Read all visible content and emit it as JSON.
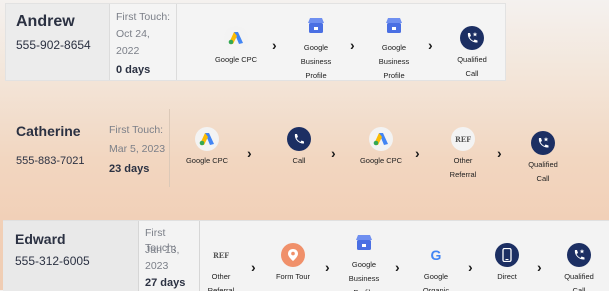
{
  "leads": [
    {
      "name": "Andrew",
      "phone": "555-902-8654",
      "first_touch_label": "First Touch:",
      "first_touch_date_line1": "Oct 24,",
      "first_touch_date_line2": "2022",
      "days": "0 days",
      "steps": [
        {
          "label": "Google CPC",
          "icon": "google-ads-icon"
        },
        {
          "label": "Google Business Profile",
          "icon": "google-business-profile-icon"
        },
        {
          "label": "Google Business Profile",
          "icon": "google-business-profile-icon"
        },
        {
          "label": "Qualified Call",
          "icon": "qualified-call-icon"
        }
      ]
    },
    {
      "name": "Catherine",
      "phone": "555-883-7021",
      "first_touch_label": "First Touch:",
      "first_touch_date_line1": "Mar 5, 2023",
      "first_touch_date_line2": "",
      "days": "23 days",
      "steps": [
        {
          "label": "Google CPC",
          "icon": "google-ads-icon"
        },
        {
          "label": "Call",
          "icon": "phone-icon"
        },
        {
          "label": "Google CPC",
          "icon": "google-ads-icon"
        },
        {
          "label": "Other Referral",
          "icon": "ref-icon"
        },
        {
          "label": "Qualified Call",
          "icon": "qualified-call-icon"
        }
      ]
    },
    {
      "name": "Edward",
      "phone": "555-312-6005",
      "first_touch_label": "First Touch:",
      "first_touch_date_line1": "Jan 13,",
      "first_touch_date_line2": "2023",
      "days": "27 days",
      "steps": [
        {
          "label": "Other Referral",
          "icon": "ref-icon"
        },
        {
          "label": "Form Tour",
          "icon": "form-tour-pin-icon"
        },
        {
          "label": "Google Business Profile",
          "icon": "google-business-profile-icon"
        },
        {
          "label": "Google Organic",
          "icon": "google-g-icon"
        },
        {
          "label": "Direct",
          "icon": "direct-device-icon"
        },
        {
          "label": "Qualified Call",
          "icon": "qualified-call-icon"
        }
      ]
    }
  ],
  "icon_text": {
    "ref": "REF"
  }
}
